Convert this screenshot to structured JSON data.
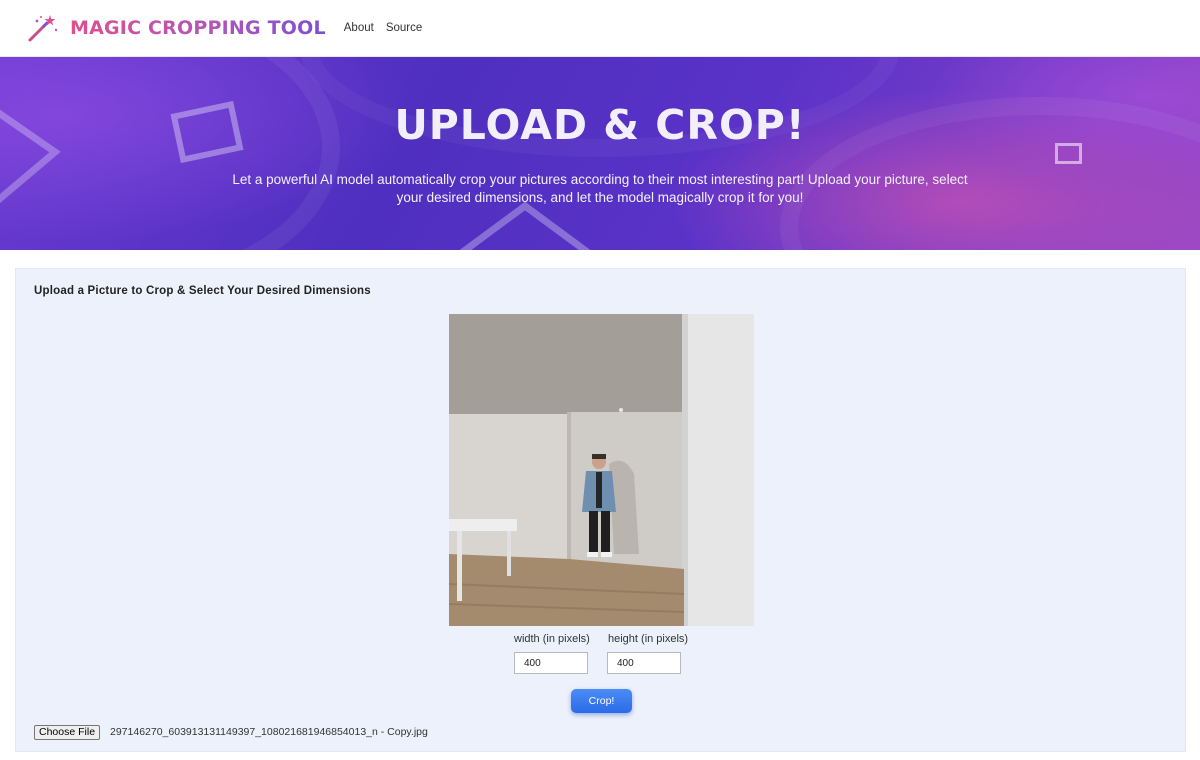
{
  "nav": {
    "brand_icon": "magic-wand-icon",
    "brand_title": "MAGIC CROPPING TOOL",
    "links": [
      "About",
      "Source"
    ]
  },
  "hero": {
    "title": "UPLOAD & CROP!",
    "description": "Let a powerful AI model automatically crop your pictures according to their most interesting part! Upload your picture, select your desired dimensions, and let the model magically crop it for you!"
  },
  "form": {
    "heading": "Upload a Picture to Crop & Select Your Desired Dimensions",
    "width_label": "width (in pixels)",
    "height_label": "height (in pixels)",
    "width_value": "400",
    "height_value": "400",
    "crop_button": "Crop!",
    "choose_file_button": "Choose File",
    "file_name": "297146270_603913131149397_108021681946854013_n - Copy.jpg"
  },
  "colors": {
    "brand_gradient_start": "#e0508f",
    "brand_gradient_end": "#7a4fd6",
    "hero_purple": "#5a32c8",
    "panel_bg": "#edf1fb",
    "button_blue": "#2b6be6"
  }
}
